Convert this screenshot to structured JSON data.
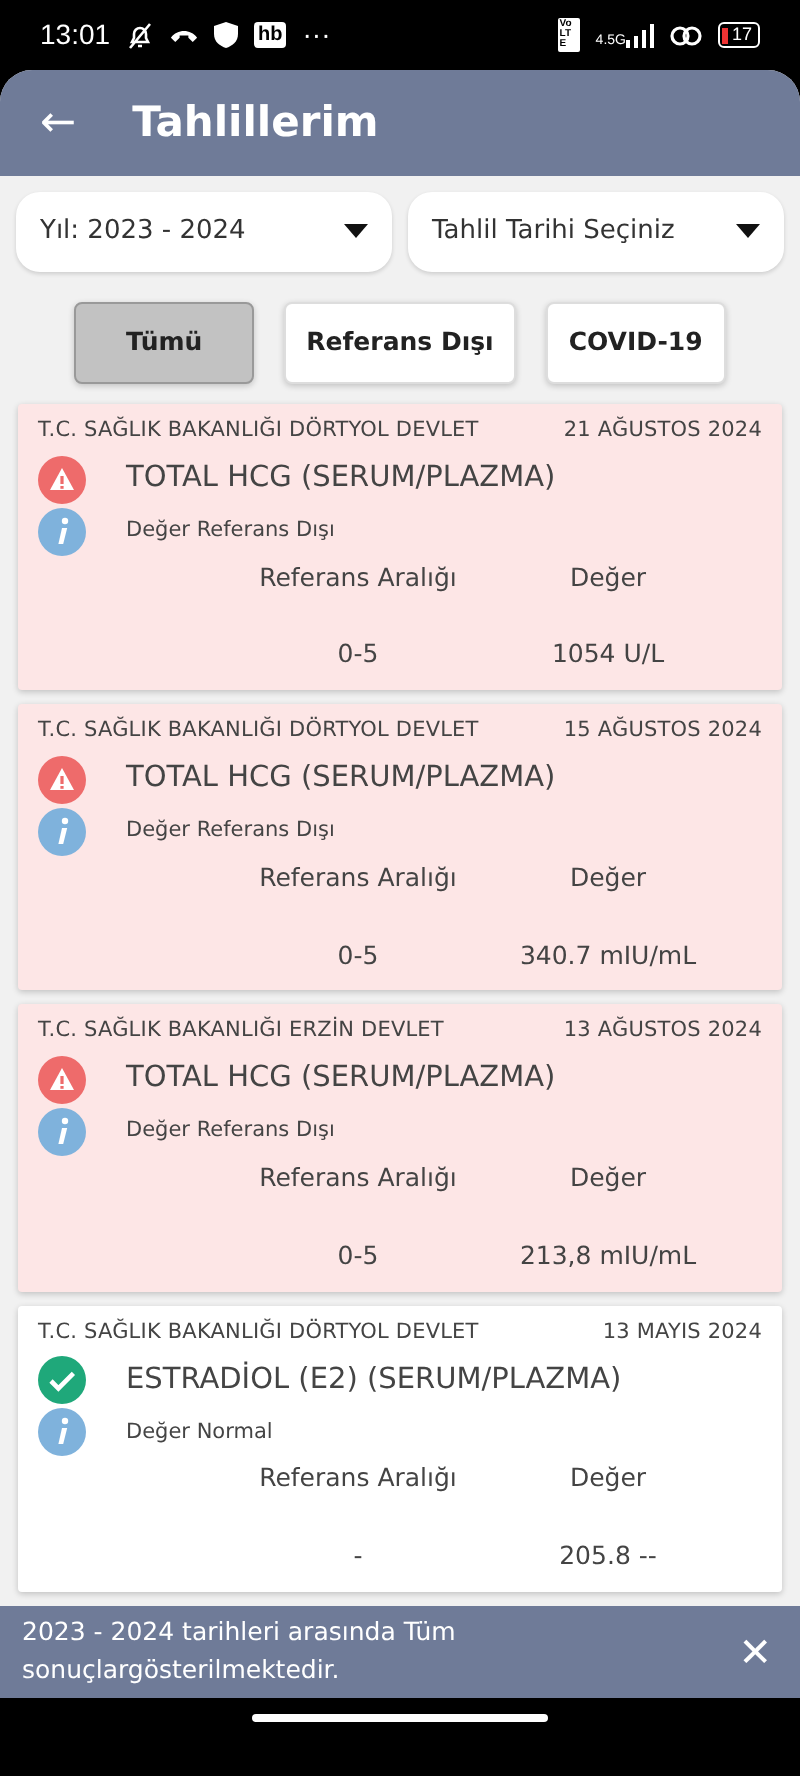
{
  "status_bar": {
    "time": "13:01",
    "app_badge": "hb",
    "more": "···",
    "volte": "Vo LTE",
    "network": "4.5G",
    "battery": "17"
  },
  "header": {
    "back": "←",
    "title": "Tahlillerim"
  },
  "dropdowns": [
    {
      "value": "Yıl: 2023 - 2024"
    },
    {
      "value": "Tahlil Tarihi Seçiniz"
    }
  ],
  "filters": [
    {
      "label": "Tümü",
      "selected": true
    },
    {
      "label": "Referans Dışı",
      "selected": false
    },
    {
      "label": "COVID-19",
      "selected": false
    }
  ],
  "results": [
    {
      "kind": "out_of_range",
      "hospital": "T.C. SAĞLIK BAKANLIĞI DÖRTYOL DEVLET",
      "date": "21 AĞUSTOS 2024",
      "test": "TOTAL HCG (SERUM/PLAZMA)",
      "status": "Değer Referans Dışı",
      "range_label": "Referans Aralığı",
      "value_label": "Değer",
      "range": "0-5",
      "value": "1054 U/L"
    },
    {
      "kind": "out_of_range",
      "hospital": "T.C. SAĞLIK BAKANLIĞI DÖRTYOL DEVLET",
      "date": "15 AĞUSTOS 2024",
      "test": "TOTAL HCG (SERUM/PLAZMA)",
      "status": "Değer Referans Dışı",
      "range_label": "Referans Aralığı",
      "value_label": "Değer",
      "range": "0-5",
      "value": "340.7 mIU/mL"
    },
    {
      "kind": "out_of_range",
      "hospital": "T.C. SAĞLIK BAKANLIĞI ERZİN DEVLET",
      "date": "13 AĞUSTOS 2024",
      "test": "TOTAL HCG (SERUM/PLAZMA)",
      "status": "Değer Referans Dışı",
      "range_label": "Referans Aralığı",
      "value_label": "Değer",
      "range": "0-5",
      "value": "213,8 mIU/mL"
    },
    {
      "kind": "normal",
      "hospital": "T.C. SAĞLIK BAKANLIĞI DÖRTYOL DEVLET",
      "date": "13 MAYIS 2024",
      "test": "ESTRADİOL (E2) (SERUM/PLAZMA)",
      "status": "Değer Normal",
      "range_label": "Referans Aralığı",
      "value_label": "Değer",
      "range": "-",
      "value": "205.8 --"
    }
  ],
  "snackbar": {
    "message": "2023 - 2024 tarihleri arasında Tüm sonuçlargösterilmektedir.",
    "close": "✕"
  }
}
